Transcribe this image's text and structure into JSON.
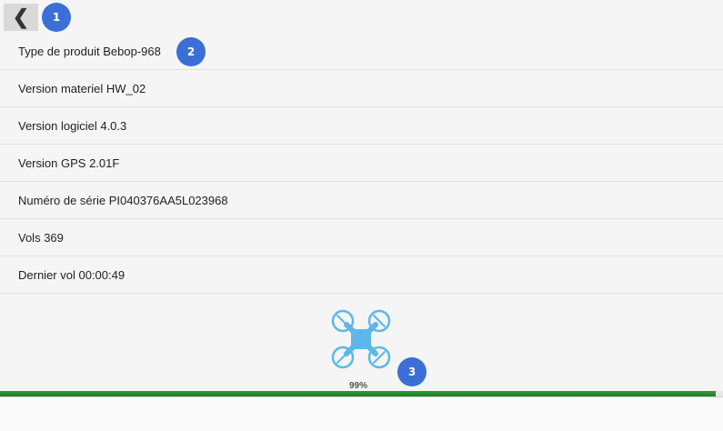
{
  "header": {
    "back_icon": "chevron-left-icon",
    "back_glyph": "❮"
  },
  "info": {
    "rows": [
      {
        "label": "Type de produit",
        "value": "Bebop-968"
      },
      {
        "label": "Version materiel",
        "value": "HW_02"
      },
      {
        "label": "Version logiciel",
        "value": "4.0.3"
      },
      {
        "label": "Version GPS",
        "value": "2.01F"
      },
      {
        "label": "Numéro de série",
        "value": "PI040376AA5L023968"
      },
      {
        "label": "Vols",
        "value": "369"
      },
      {
        "label": "Dernier vol",
        "value": "00:00:49"
      }
    ]
  },
  "progress": {
    "percent": 99,
    "label": "99%"
  },
  "badges": [
    "1",
    "2",
    "3"
  ],
  "colors": {
    "accent": "#3b6fd6",
    "progress": "#2e9e34",
    "drone": "#5bb8e8"
  },
  "icons": {
    "drone": "quadcopter-drone-icon"
  }
}
